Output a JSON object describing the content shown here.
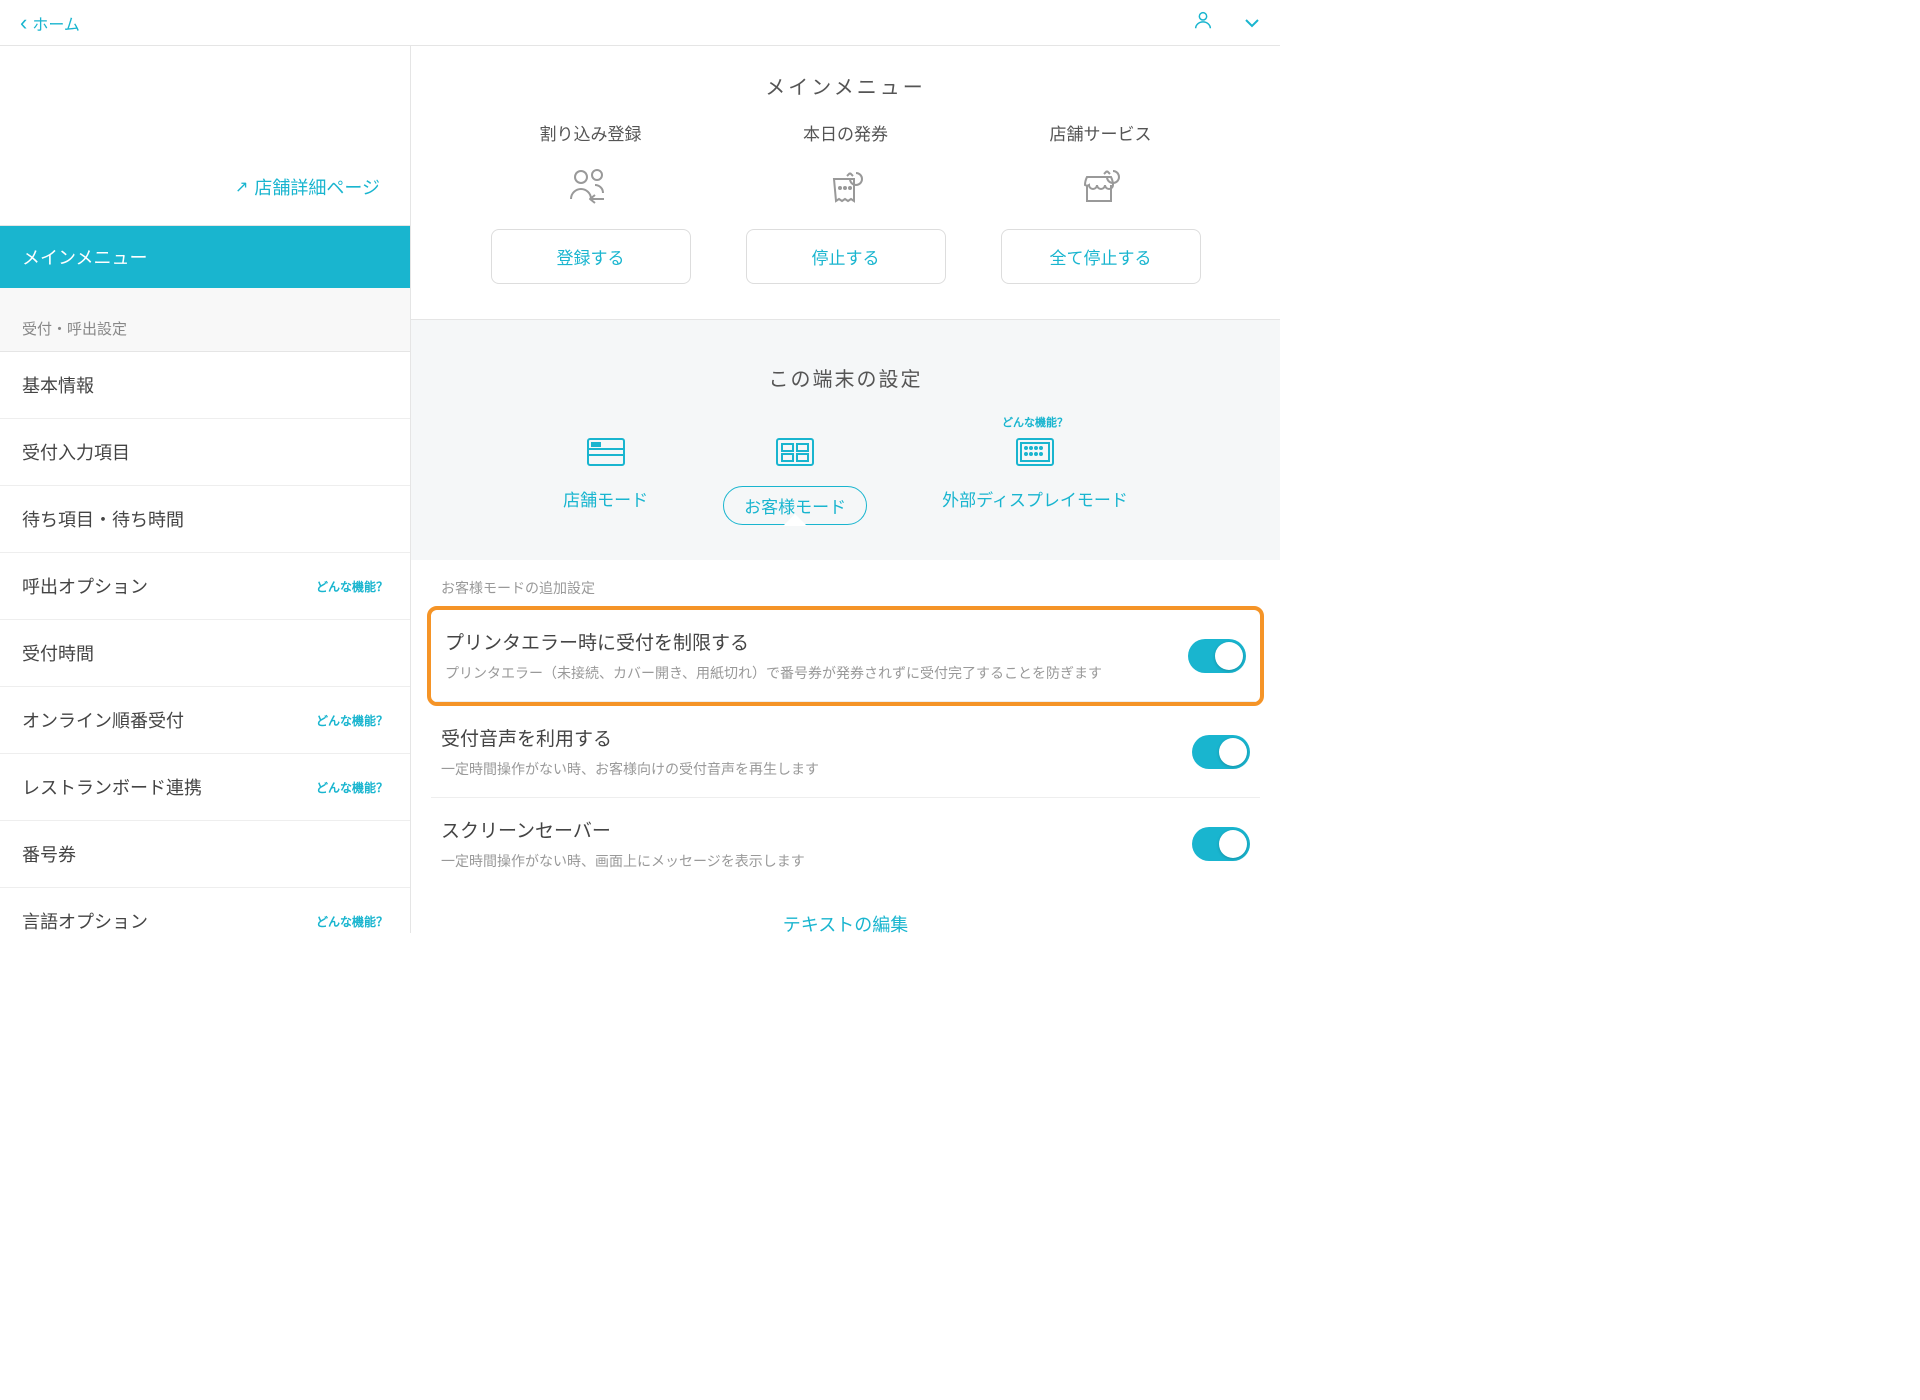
{
  "header": {
    "back_label": "ホーム"
  },
  "sidebar": {
    "store_detail_link": "店舗詳細ページ",
    "active_item": "メインメニュー",
    "section1_header": "受付・呼出設定",
    "items": [
      {
        "label": "基本情報",
        "badge": ""
      },
      {
        "label": "受付入力項目",
        "badge": ""
      },
      {
        "label": "待ち項目・待ち時間",
        "badge": ""
      },
      {
        "label": "呼出オプション",
        "badge": "どんな機能？"
      },
      {
        "label": "受付時間",
        "badge": ""
      },
      {
        "label": "オンライン順番受付",
        "badge": "どんな機能？"
      },
      {
        "label": "レストランボード連携",
        "badge": "どんな機能？"
      },
      {
        "label": "番号券",
        "badge": ""
      },
      {
        "label": "言語オプション",
        "badge": "どんな機能？"
      }
    ]
  },
  "main_menu": {
    "title": "メインメニュー",
    "cards": [
      {
        "label": "割り込み登録",
        "button": "登録する"
      },
      {
        "label": "本日の発券",
        "button": "停止する"
      },
      {
        "label": "店舗サービス",
        "button": "全て停止する"
      }
    ]
  },
  "device": {
    "title": "この端末の設定",
    "modes": [
      {
        "label": "店舗モード",
        "hint": ""
      },
      {
        "label": "お客様モード",
        "hint": ""
      },
      {
        "label": "外部ディスプレイモード",
        "hint": "どんな機能？"
      }
    ],
    "subheader": "お客様モードの追加設定",
    "settings": [
      {
        "title": "プリンタエラー時に受付を制限する",
        "desc": "プリンタエラー（未接続、カバー開き、用紙切れ）で番号券が発券されずに受付完了することを防ぎます",
        "on": true
      },
      {
        "title": "受付音声を利用する",
        "desc": "一定時間操作がない時、お客様向けの受付音声を再生します",
        "on": true
      },
      {
        "title": "スクリーンセーバー",
        "desc": "一定時間操作がない時、画面上にメッセージを表示します",
        "on": true
      }
    ],
    "edit_text": "テキストの編集"
  }
}
